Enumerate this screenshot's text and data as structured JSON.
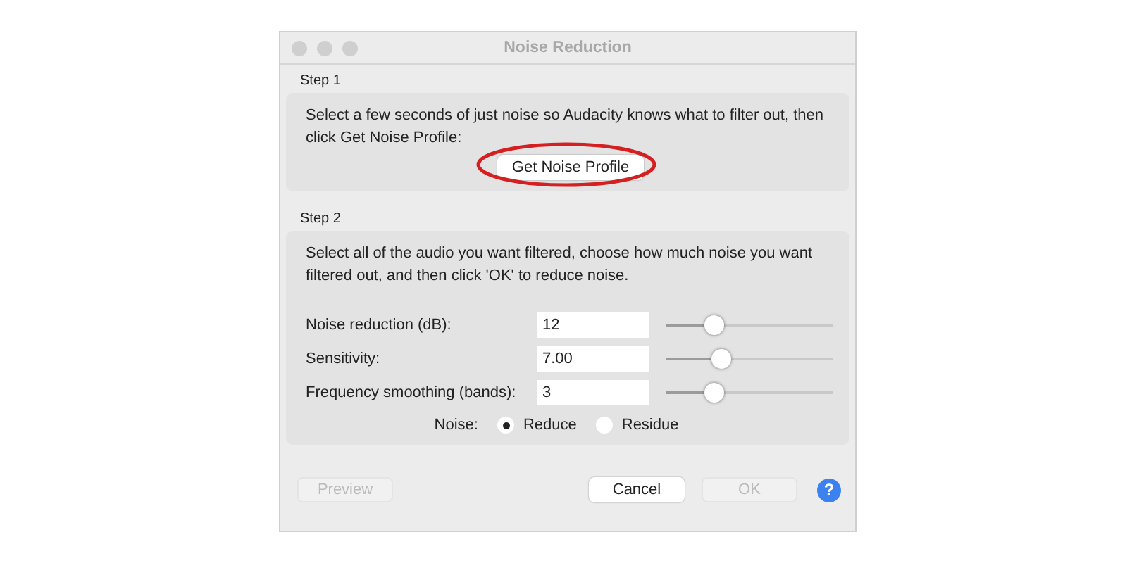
{
  "window": {
    "title": "Noise Reduction"
  },
  "step1": {
    "label": "Step 1",
    "text": "Select a few seconds of just noise so Audacity knows what to filter out, then click Get Noise Profile:",
    "button": {
      "label": "Get Noise Profile",
      "highlighted": true
    }
  },
  "step2": {
    "label": "Step 2",
    "text": "Select all of the audio you want filtered, choose how much noise you want filtered out, and then click 'OK' to reduce noise.",
    "settings": [
      {
        "label": "Noise reduction (dB):",
        "value": "12",
        "level": 0.29
      },
      {
        "label": "Sensitivity:",
        "value": "7.00",
        "level": 0.33
      },
      {
        "label": "Frequency smoothing (bands):",
        "value": "3",
        "level": 0.29
      }
    ],
    "noise": {
      "label": "Noise:",
      "options": [
        {
          "label": "Reduce",
          "selected": true
        },
        {
          "label": "Residue",
          "selected": false
        }
      ]
    }
  },
  "buttons": [
    {
      "label": "Preview",
      "disabled": true
    },
    {
      "label": "Cancel",
      "disabled": false
    },
    {
      "label": "OK",
      "disabled": true
    }
  ],
  "help": "?"
}
